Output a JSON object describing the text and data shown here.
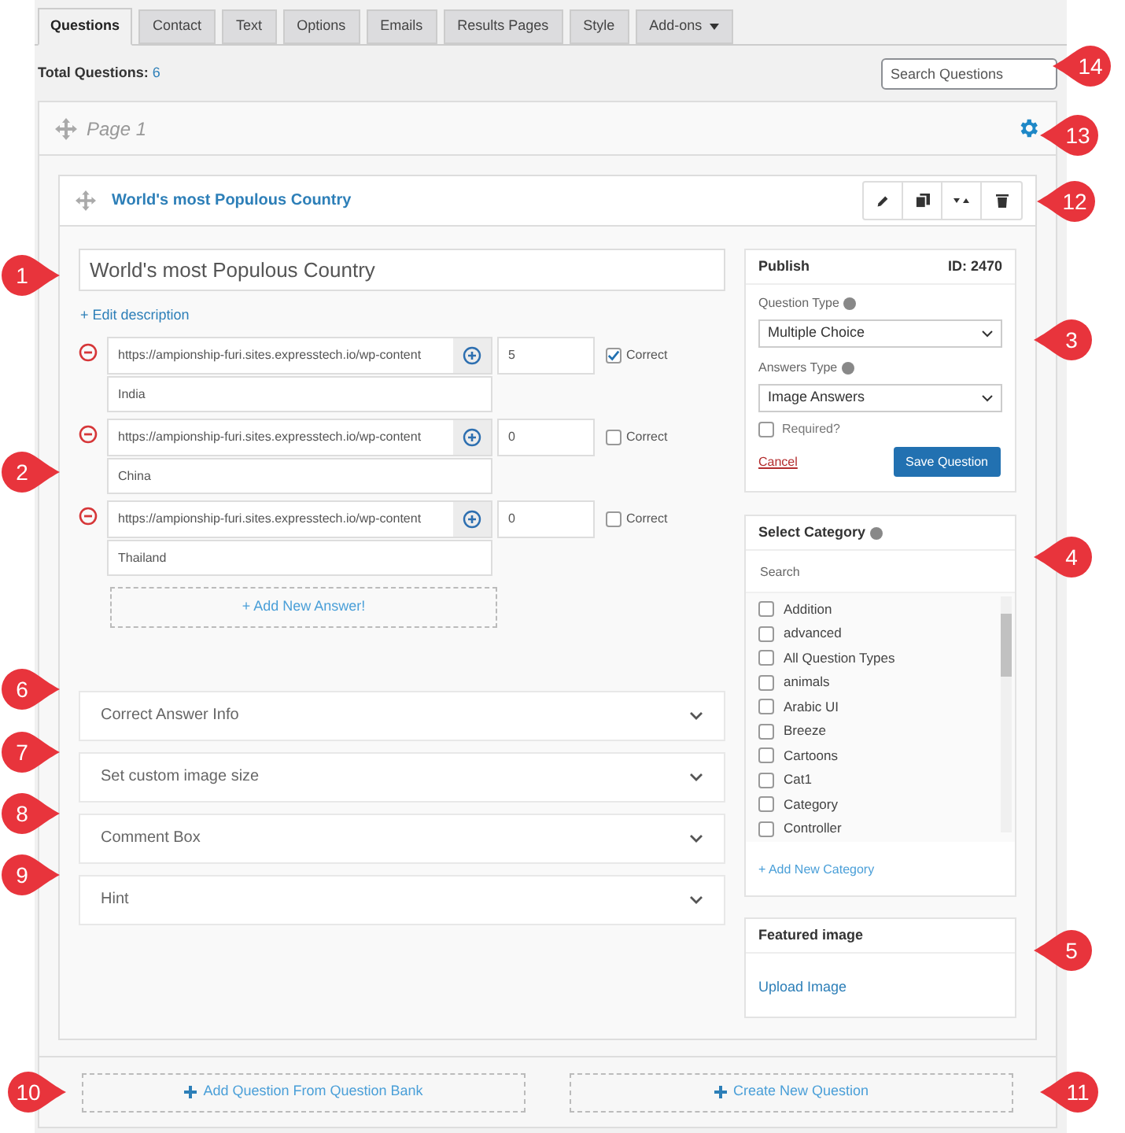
{
  "tabs": [
    {
      "label": "Questions",
      "selected": true
    },
    {
      "label": "Contact",
      "selected": false
    },
    {
      "label": "Text",
      "selected": false
    },
    {
      "label": "Options",
      "selected": false
    },
    {
      "label": "Emails",
      "selected": false
    },
    {
      "label": "Results Pages",
      "selected": false
    },
    {
      "label": "Style",
      "selected": false
    },
    {
      "label": "Add-ons",
      "selected": false,
      "dropdown": true
    }
  ],
  "total": {
    "label": "Total Questions:",
    "value": "6"
  },
  "search": {
    "placeholder": "Search Questions"
  },
  "page": {
    "title": "Page 1"
  },
  "question": {
    "title": "World's most Populous Country",
    "name_value": "World's most Populous Country",
    "edit_description": "+ Edit description",
    "answers": [
      {
        "url": "https://ampionship-furi.sites.expresstech.io/wp-content",
        "points": "5",
        "correct": true,
        "correct_label": "Correct",
        "caption": "India"
      },
      {
        "url": "https://ampionship-furi.sites.expresstech.io/wp-content",
        "points": "0",
        "correct": false,
        "correct_label": "Correct",
        "caption": "China"
      },
      {
        "url": "https://ampionship-furi.sites.expresstech.io/wp-content",
        "points": "0",
        "correct": false,
        "correct_label": "Correct",
        "caption": "Thailand"
      }
    ],
    "add_answer": "+ Add New Answer!",
    "sections": [
      {
        "label": "Correct Answer Info",
        "expanded": false
      },
      {
        "label": "Set custom image size",
        "expanded": false
      },
      {
        "label": "Comment Box",
        "expanded": false
      },
      {
        "label": "Hint",
        "expanded": false
      }
    ]
  },
  "publish": {
    "title": "Publish",
    "id": "ID: 2470",
    "question_type_label": "Question Type",
    "question_type": "Multiple Choice",
    "answers_type_label": "Answers Type",
    "answers_type": "Image Answers",
    "required_label": "Required?",
    "required": false,
    "cancel": "Cancel",
    "save": "Save Question"
  },
  "category": {
    "title": "Select Category",
    "search_placeholder": "Search",
    "items": [
      {
        "label": "Addition",
        "checked": false
      },
      {
        "label": "advanced",
        "checked": false
      },
      {
        "label": "All Question Types",
        "checked": false
      },
      {
        "label": "animals",
        "checked": false
      },
      {
        "label": "Arabic UI",
        "checked": false
      },
      {
        "label": "Breeze",
        "checked": false
      },
      {
        "label": "Cartoons",
        "checked": false
      },
      {
        "label": "Cat1",
        "checked": false
      },
      {
        "label": "Category",
        "checked": false
      },
      {
        "label": "Controller",
        "checked": false
      }
    ],
    "add": "+ Add New Category"
  },
  "featured": {
    "title": "Featured image",
    "upload": "Upload Image"
  },
  "bottom": {
    "add_from_bank": "Add Question From Question Bank",
    "create": "Create New Question"
  },
  "callouts": [
    "14",
    "13",
    "12",
    "1",
    "3",
    "2",
    "4",
    "6",
    "7",
    "8",
    "9",
    "5",
    "10",
    "11"
  ]
}
